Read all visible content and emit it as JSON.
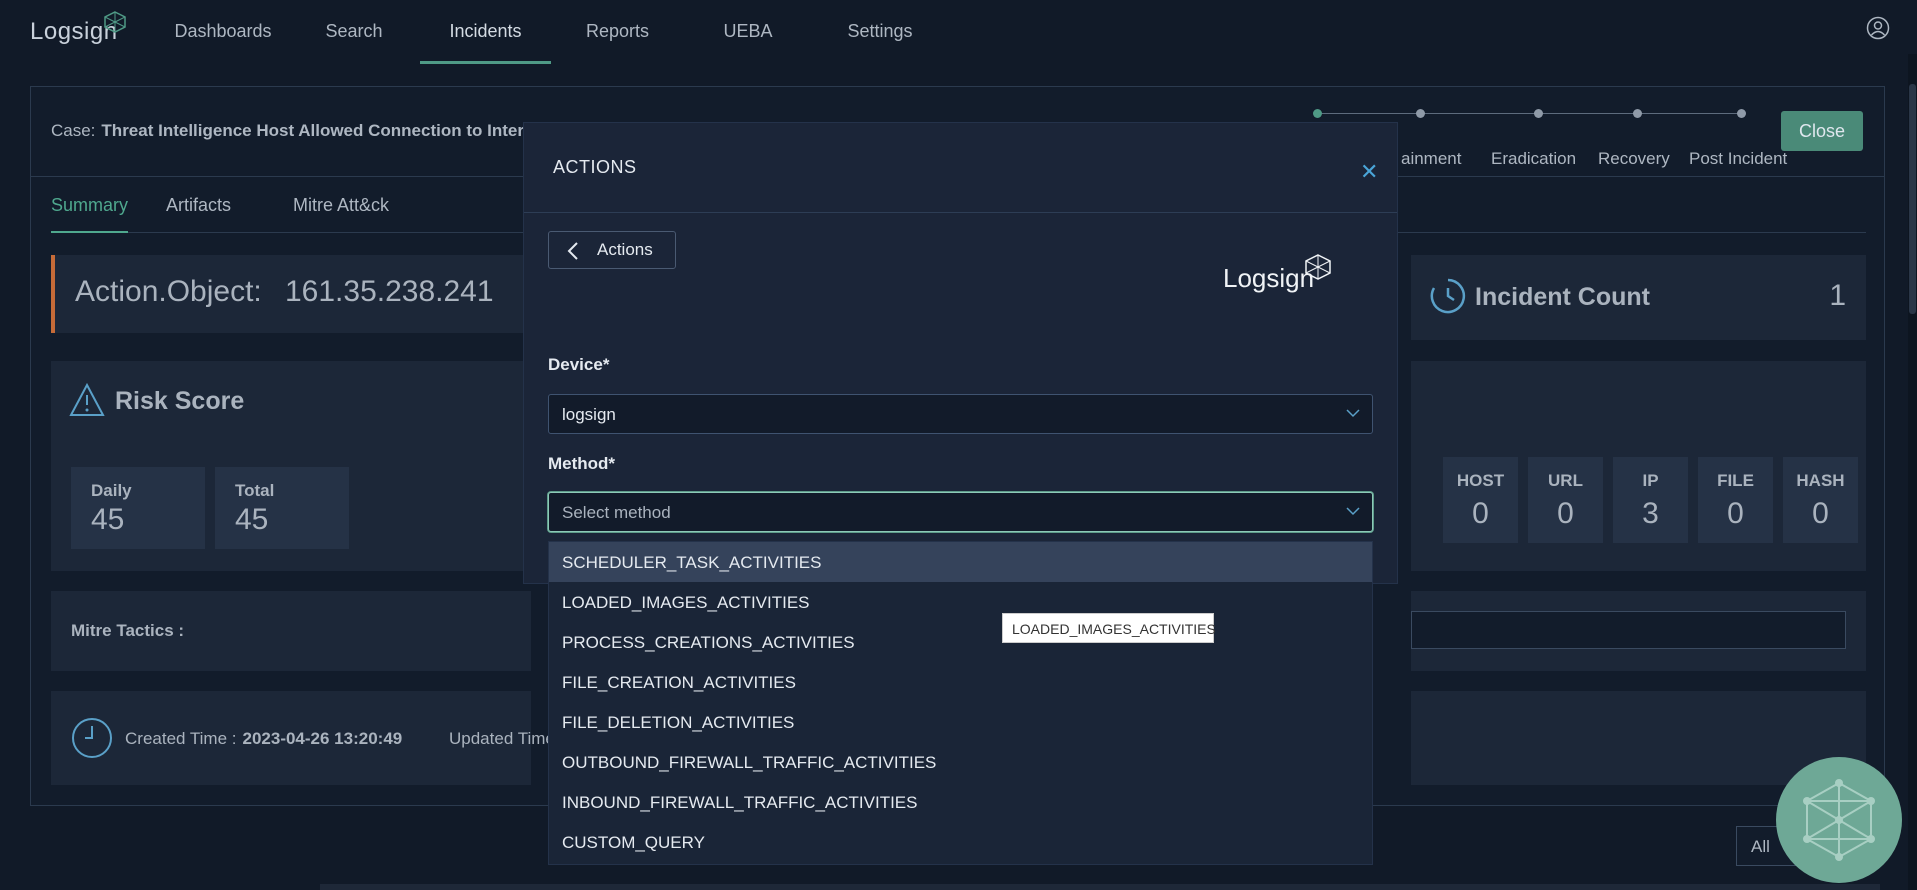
{
  "nav": {
    "brand": "Logsign",
    "items": [
      {
        "label": "Dashboards"
      },
      {
        "label": "Search"
      },
      {
        "label": "Incidents"
      },
      {
        "label": "Reports"
      },
      {
        "label": "UEBA"
      },
      {
        "label": "Settings"
      }
    ],
    "active": "Incidents"
  },
  "case": {
    "label": "Case:",
    "title": "Threat Intelligence Host Allowed Connection to Interna",
    "steps": [
      "",
      "ainment",
      "Eradication",
      "Recovery",
      "Post Incident"
    ],
    "close_label": "Close"
  },
  "tabs": [
    "Summary",
    "Artifacts",
    "Mitre Att&ck"
  ],
  "action_object": {
    "label": "Action.Object:",
    "value": "161.35.238.241"
  },
  "risk": {
    "title": "Risk Score",
    "daily_label": "Daily",
    "daily_value": "45",
    "total_label": "Total",
    "total_value": "45"
  },
  "mitre": {
    "label": "Mitre Tactics :"
  },
  "times": {
    "created_label": "Created Time :",
    "created_value": "2023-04-26 13:20:49",
    "updated_label": "Updated Time :"
  },
  "incident_count": {
    "title": "Incident Count",
    "value": "1"
  },
  "artifacts": [
    {
      "label": "HOST",
      "value": "0"
    },
    {
      "label": "URL",
      "value": "0"
    },
    {
      "label": "IP",
      "value": "3"
    },
    {
      "label": "FILE",
      "value": "0"
    },
    {
      "label": "HASH",
      "value": "0"
    }
  ],
  "filter_all": "All",
  "modal": {
    "title": "ACTIONS",
    "back_label": "Actions",
    "logo": "Logsign",
    "device_label": "Device*",
    "device_value": "logsign",
    "method_label": "Method*",
    "method_placeholder": "Select method",
    "options": [
      "SCHEDULER_TASK_ACTIVITIES",
      "LOADED_IMAGES_ACTIVITIES",
      "PROCESS_CREATIONS_ACTIVITIES",
      "FILE_CREATION_ACTIVITIES",
      "FILE_DELETION_ACTIVITIES",
      "OUTBOUND_FIREWALL_TRAFFIC_ACTIVITIES",
      "INBOUND_FIREWALL_TRAFFIC_ACTIVITIES",
      "CUSTOM_QUERY"
    ],
    "tooltip": "LOADED_IMAGES_ACTIVITIES"
  },
  "colors": {
    "accent": "#4fa88e",
    "object_border": "#c66b38",
    "close_button": "#4a8a78"
  }
}
